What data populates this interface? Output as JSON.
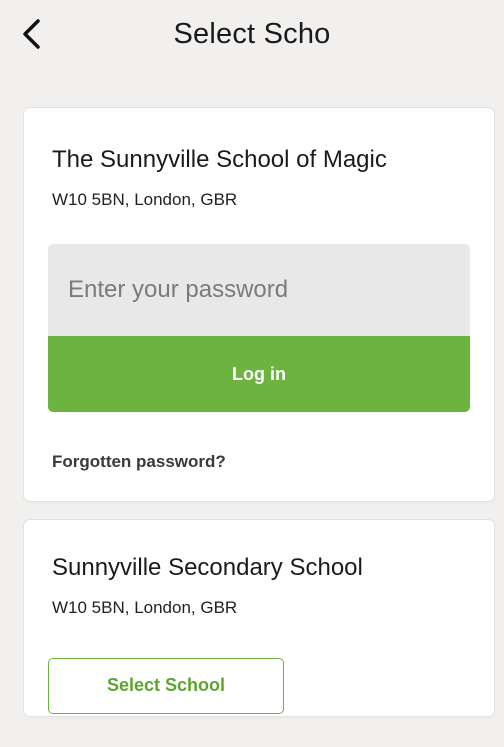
{
  "header": {
    "title": "Select Scho",
    "back_icon": "chevron-left-icon"
  },
  "schools": [
    {
      "name": "The Sunnyville School of Magic",
      "address": "W10 5BN, London, GBR",
      "password_placeholder": "Enter your password",
      "login_label": "Log in",
      "forgot_label": "Forgotten password?"
    },
    {
      "name": "Sunnyville Secondary School",
      "address": "W10 5BN, London, GBR",
      "select_label": "Select School"
    }
  ],
  "colors": {
    "background": "#f1f0ef",
    "accent_green": "#6db33f",
    "input_bg": "#e8e8e8"
  }
}
